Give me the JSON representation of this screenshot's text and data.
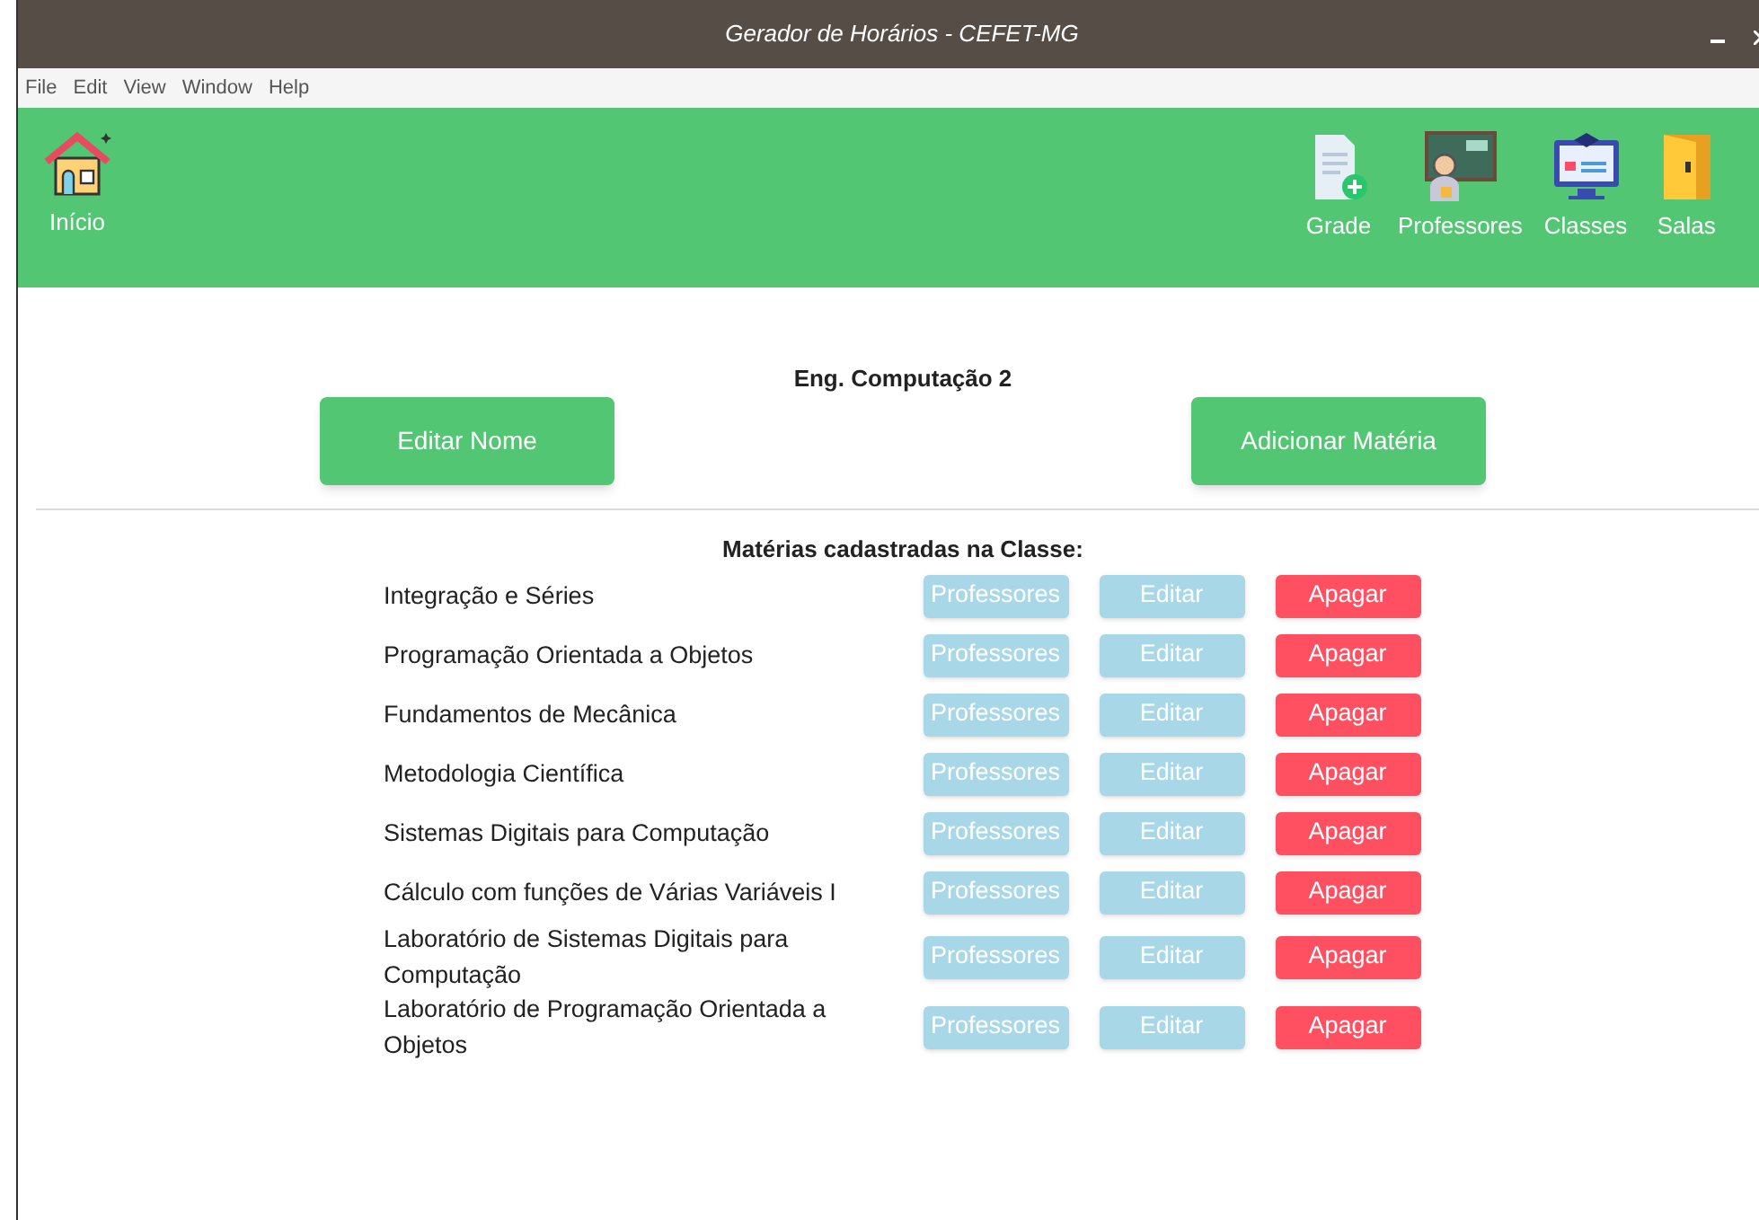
{
  "window": {
    "title": "Gerador de Horários - CEFET-MG"
  },
  "menu": [
    "File",
    "Edit",
    "View",
    "Window",
    "Help"
  ],
  "toolbar": {
    "home": {
      "kind": "home",
      "label": "Início"
    },
    "items": [
      {
        "kind": "grade",
        "label": "Grade"
      },
      {
        "kind": "teacher",
        "label": "Professores"
      },
      {
        "kind": "classes",
        "label": "Classes"
      },
      {
        "kind": "door",
        "label": "Salas"
      }
    ]
  },
  "class_name": "Eng. Computação 2",
  "actions": [
    "Editar Nome",
    "Adicionar Matéria"
  ],
  "subjects_heading": "Matérias cadastradas na Classe:",
  "subjects": [
    {
      "name": "Integração e Séries",
      "buttons": [
        {
          "kind": "light",
          "label": "Professores"
        },
        {
          "kind": "light",
          "label": "Editar"
        },
        {
          "kind": "danger",
          "label": "Apagar"
        }
      ]
    },
    {
      "name": "Programação Orientada a Objetos",
      "buttons": [
        {
          "kind": "light",
          "label": "Professores"
        },
        {
          "kind": "light",
          "label": "Editar"
        },
        {
          "kind": "danger",
          "label": "Apagar"
        }
      ]
    },
    {
      "name": "Fundamentos de Mecânica",
      "buttons": [
        {
          "kind": "light",
          "label": "Professores"
        },
        {
          "kind": "light",
          "label": "Editar"
        },
        {
          "kind": "danger",
          "label": "Apagar"
        }
      ]
    },
    {
      "name": "Metodologia Científica",
      "buttons": [
        {
          "kind": "light",
          "label": "Professores"
        },
        {
          "kind": "light",
          "label": "Editar"
        },
        {
          "kind": "danger",
          "label": "Apagar"
        }
      ]
    },
    {
      "name": "Sistemas Digitais para Computação",
      "buttons": [
        {
          "kind": "light",
          "label": "Professores"
        },
        {
          "kind": "light",
          "label": "Editar"
        },
        {
          "kind": "danger",
          "label": "Apagar"
        }
      ]
    },
    {
      "name": "Cálculo com funções de Várias Variáveis I",
      "buttons": [
        {
          "kind": "light",
          "label": "Professores"
        },
        {
          "kind": "light",
          "label": "Editar"
        },
        {
          "kind": "danger",
          "label": "Apagar"
        }
      ]
    },
    {
      "name": "Laboratório de Sistemas Digitais para Computação",
      "buttons": [
        {
          "kind": "light",
          "label": "Professores"
        },
        {
          "kind": "light",
          "label": "Editar"
        },
        {
          "kind": "danger",
          "label": "Apagar"
        }
      ]
    },
    {
      "name": "Laboratório de Programação Orientada a Objetos",
      "buttons": [
        {
          "kind": "light",
          "label": "Professores"
        },
        {
          "kind": "light",
          "label": "Editar"
        },
        {
          "kind": "danger",
          "label": "Apagar"
        }
      ]
    }
  ]
}
